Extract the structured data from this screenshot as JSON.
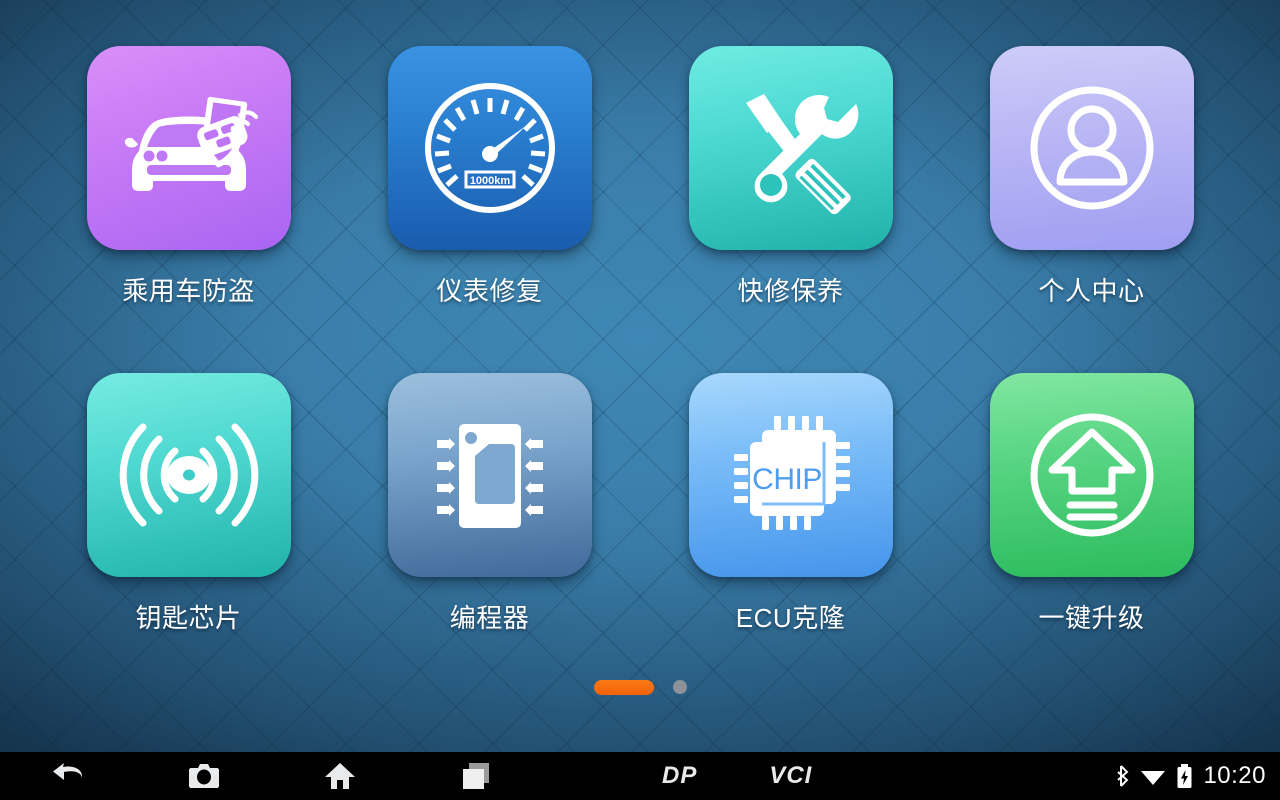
{
  "wallpaper": {
    "bg_center_color": "#3f87b4",
    "bg_edge_color": "#16364e",
    "pattern": "diagonal-diamond-grid"
  },
  "home_screen": {
    "apps": [
      {
        "label": "乘用车防盗",
        "icon": "car-key-shield-icon",
        "grad_from": "#d67ef7",
        "grad_to": "#9b5bf0"
      },
      {
        "label": "仪表修复",
        "icon": "speedometer-icon",
        "grad_from": "#2f8fe0",
        "grad_to": "#1659a8",
        "odometer_text": "1000km"
      },
      {
        "label": "快修保养",
        "icon": "wrench-screwdriver-icon",
        "grad_from": "#65e6dc",
        "grad_to": "#22b5ab"
      },
      {
        "label": "个人中心",
        "icon": "user-circle-icon",
        "grad_from": "#c3c2f6",
        "grad_to": "#a6a4f2"
      },
      {
        "label": "钥匙芯片",
        "icon": "transponder-signal-icon",
        "grad_from": "#6ee6df",
        "grad_to": "#24b6ac"
      },
      {
        "label": "编程器",
        "icon": "eeprom-chip-icon",
        "grad_from": "#8fb6d8",
        "grad_to": "#46709c"
      },
      {
        "label": "ECU克隆",
        "icon": "cpu-chip-icon",
        "grad_from": "#9ed2fb",
        "grad_to": "#4d9ef0",
        "chip_text": "CHIP"
      },
      {
        "label": "一键升级",
        "icon": "upload-arrow-circle-icon",
        "grad_from": "#78e39a",
        "grad_to": "#31bf62"
      }
    ]
  },
  "pager": {
    "pages": 2,
    "active_index": 0,
    "active_color": "#f76b10",
    "inactive_color": "#8d9298"
  },
  "navbar": {
    "buttons": [
      {
        "name": "back",
        "icon": "back-arrow-icon"
      },
      {
        "name": "screenshot",
        "icon": "camera-icon"
      },
      {
        "name": "home",
        "icon": "home-icon"
      },
      {
        "name": "recents",
        "icon": "recent-apps-icon"
      }
    ],
    "logos": {
      "dp": "DP",
      "vci": "VCI"
    },
    "status": {
      "bluetooth_icon": "bluetooth-icon",
      "wifi_icon": "wifi-icon",
      "battery_icon": "battery-charging-icon",
      "time": "10:20"
    }
  }
}
